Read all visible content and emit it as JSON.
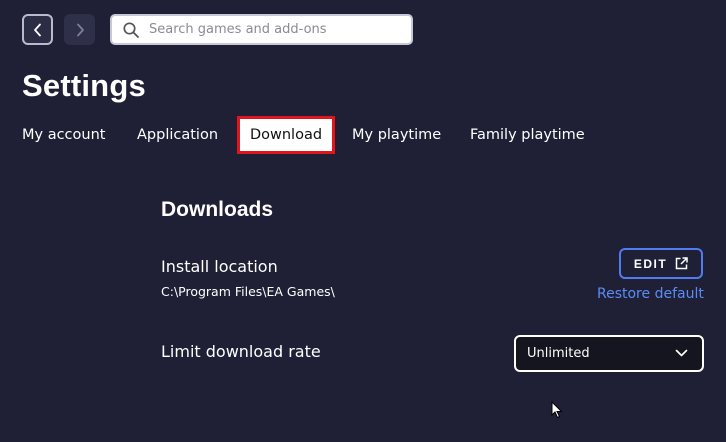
{
  "nav": {
    "back_icon": "chevron-left-icon",
    "forward_icon": "chevron-right-icon"
  },
  "search": {
    "placeholder": "Search games and add-ons",
    "icon": "search-icon"
  },
  "page": {
    "title": "Settings"
  },
  "tabs": [
    {
      "label": "My account",
      "active": false
    },
    {
      "label": "Application",
      "active": false
    },
    {
      "label": "Download",
      "active": true
    },
    {
      "label": "My playtime",
      "active": false
    },
    {
      "label": "Family playtime",
      "active": false
    }
  ],
  "downloads": {
    "section_title": "Downloads",
    "install_location": {
      "label": "Install location",
      "path": "C:\\Program Files\\EA Games\\",
      "edit_label": "EDIT",
      "edit_icon": "external-link-icon",
      "restore_label": "Restore default"
    },
    "download_rate": {
      "label": "Limit download rate",
      "selected": "Unlimited",
      "icon": "chevron-down-icon"
    }
  },
  "colors": {
    "background": "#1f2035",
    "accent_blue": "#4f7df0",
    "link_blue": "#5b8cf5",
    "highlight_red": "#e2151d"
  }
}
